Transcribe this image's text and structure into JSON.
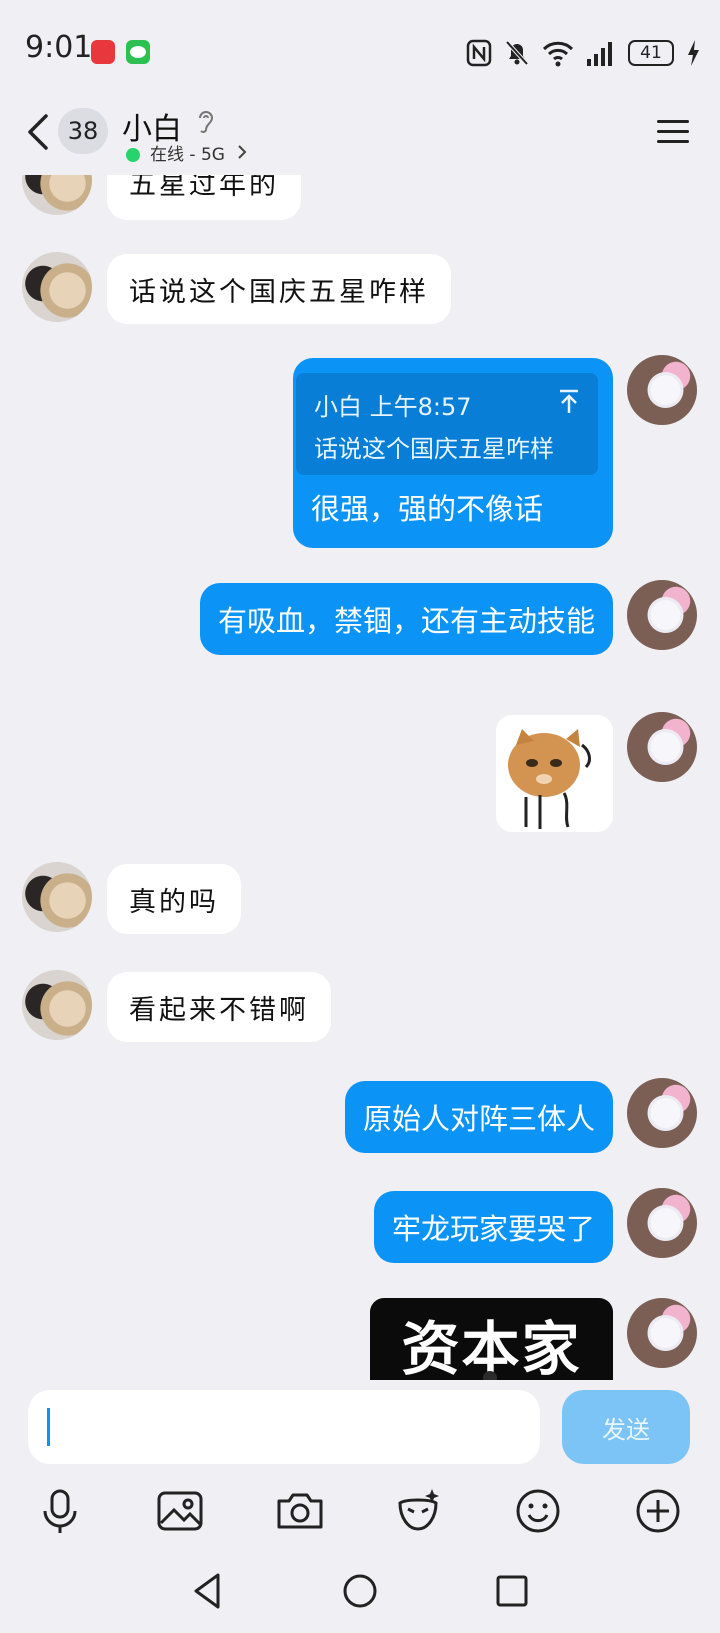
{
  "status_bar": {
    "time": "9:01",
    "battery": "41",
    "icons": [
      "nfc-icon",
      "mute-icon",
      "wifi-icon",
      "signal-icon",
      "battery-icon",
      "charging-icon"
    ],
    "app_badges": [
      "huawei-appgallery-icon",
      "wechat-icon"
    ]
  },
  "header": {
    "unread_count": "38",
    "contact_name": "小白",
    "status": "在线 - 5G",
    "status_color": "#27d36b"
  },
  "messages": [
    {
      "side": "other",
      "type": "text",
      "text": "五星过年的"
    },
    {
      "side": "other",
      "type": "text",
      "text": "话说这个国庆五星咋样"
    },
    {
      "side": "self",
      "type": "reply",
      "quote_meta": "小白 上午8:57",
      "quote_text": "话说这个国庆五星咋样",
      "text": "很强，强的不像话"
    },
    {
      "side": "self",
      "type": "text",
      "text": "有吸血，禁锢，还有主动技能"
    },
    {
      "side": "self",
      "type": "sticker",
      "sticker": "cat-sticker"
    },
    {
      "side": "other",
      "type": "text",
      "text": "真的吗"
    },
    {
      "side": "other",
      "type": "text",
      "text": "看起来不错啊"
    },
    {
      "side": "self",
      "type": "text",
      "text": "原始人对阵三体人"
    },
    {
      "side": "self",
      "type": "text",
      "text": "牢龙玩家要哭了"
    },
    {
      "side": "self",
      "type": "image",
      "caption": "资本家"
    }
  ],
  "input": {
    "value": "",
    "send_label": "发送"
  },
  "toolbar": [
    "mic-icon",
    "image-icon",
    "camera-icon",
    "ai-mask-icon",
    "emoji-icon",
    "plus-icon"
  ],
  "colors": {
    "background": "#efeff4",
    "self_bubble": "#0b93f6",
    "other_bubble": "#ffffff",
    "send_disabled": "#7cc4f5"
  }
}
